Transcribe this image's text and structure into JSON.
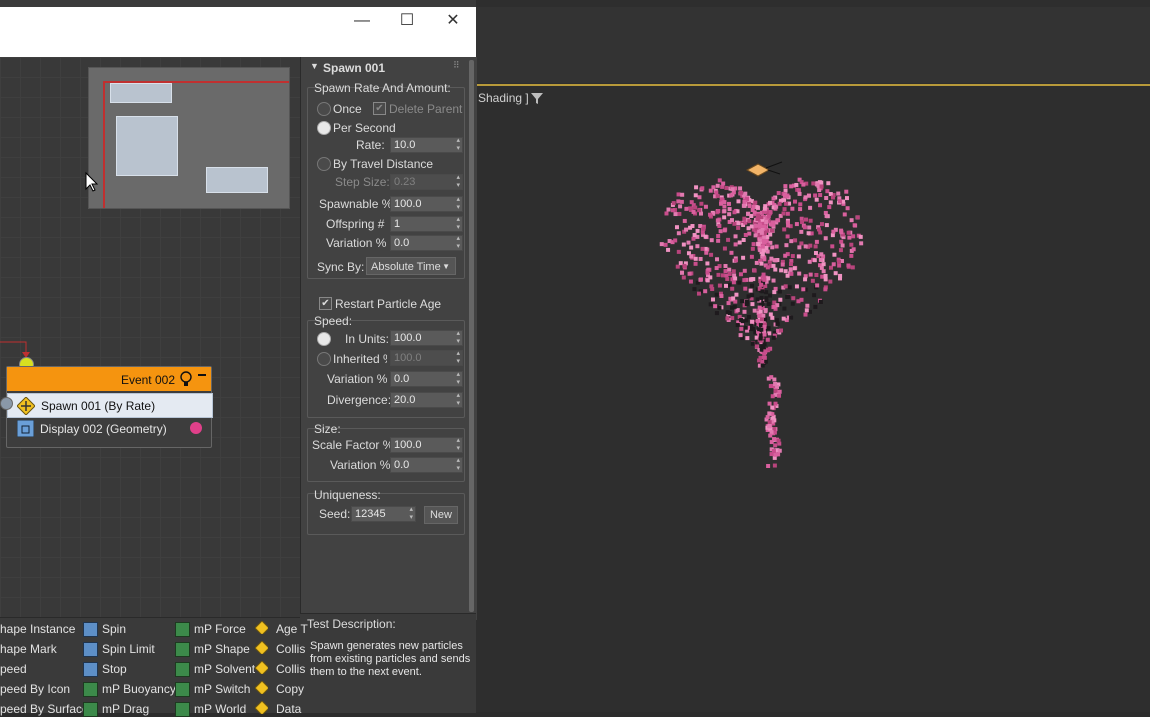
{
  "viewport": {
    "shading_label": "Shading ]"
  },
  "window": {
    "controls": [
      "—",
      "☐",
      "✕"
    ]
  },
  "event": {
    "title": "Event 002",
    "operators": [
      {
        "label": "Spawn 001 (By Rate)"
      },
      {
        "label": "Display 002 (Geometry)"
      }
    ]
  },
  "panel": {
    "title": "Spawn 001",
    "spawn_group": "Spawn Rate And Amount:",
    "once": "Once",
    "delete_parent": "Delete Parent",
    "per_second": "Per Second",
    "rate_label": "Rate:",
    "rate_value": "10.0",
    "by_travel": "By Travel Distance",
    "step_label": "Step Size:",
    "step_value": "0.23",
    "spawnable_label": "Spawnable %",
    "spawnable_value": "100.0",
    "offspring_label": "Offspring #",
    "offspring_value": "1",
    "variation_label": "Variation %",
    "variation_value": "0.0",
    "sync_label": "Sync By:",
    "sync_value": "Absolute Time",
    "restart_label": "Restart Particle Age",
    "speed_label": "Speed:",
    "in_units_label": "In Units:",
    "in_units_value": "100.0",
    "inherited_label": "Inherited %",
    "inherited_value": "100.0",
    "speed_variation_label": "Variation %",
    "speed_variation_value": "0.0",
    "divergence_label": "Divergence:",
    "divergence_value": "20.0",
    "size_label": "Size:",
    "scale_label": "Scale Factor %",
    "scale_value": "100.0",
    "size_variation_label": "Variation %",
    "size_variation_value": "0.0",
    "uniqueness_label": "Uniqueness:",
    "seed_label": "Seed:",
    "seed_value": "12345",
    "new_button": "New"
  },
  "description": {
    "title": "Test Description:",
    "text": "Spawn generates new particles from existing particles and sends them to the next event."
  },
  "depot": {
    "col1": [
      "hape Instance",
      "hape Mark",
      "peed",
      "peed By Icon",
      "peed By Surface"
    ],
    "col2": [
      "Spin",
      "Spin Limit",
      "Stop",
      "mP Buoyancy",
      "mP Drag"
    ],
    "col3": [
      "mP Force",
      "mP Shape",
      "mP Solvent",
      "mP Switch",
      "mP World"
    ],
    "col4": [
      "Age T",
      "Collis",
      "Collis",
      "Copy",
      "Data"
    ]
  }
}
